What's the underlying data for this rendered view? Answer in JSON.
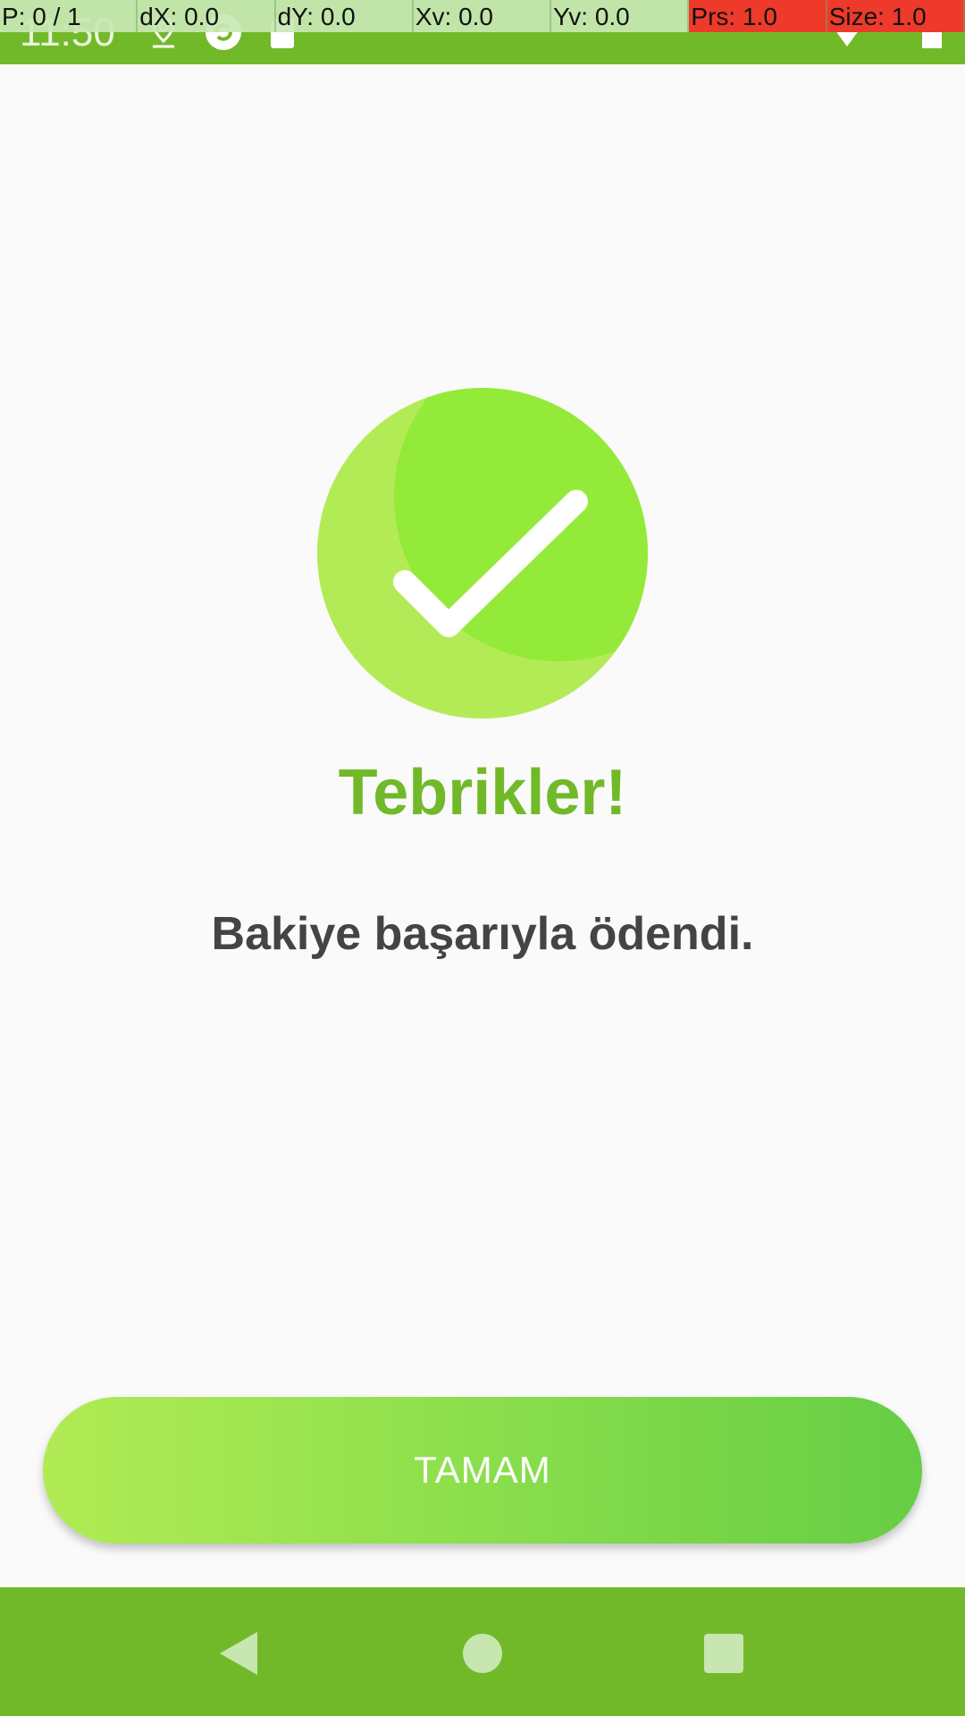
{
  "status_bar": {
    "time": "11:50",
    "icons": [
      "location-icon",
      "sync-icon",
      "sd-card-icon",
      "wifi-icon",
      "battery-icon"
    ],
    "background_color": "#72b92a"
  },
  "pointer_overlay": {
    "cells": [
      {
        "label": "P: 0 / 1"
      },
      {
        "label": "dX: 0.0"
      },
      {
        "label": "dY: 0.0"
      },
      {
        "label": "Xv: 0.0"
      },
      {
        "label": "Yv: 0.0"
      },
      {
        "label": "Prs: 1.0"
      },
      {
        "label": "Size: 1.0"
      }
    ]
  },
  "success": {
    "icon": "checkmark-icon",
    "title": "Tebrikler!",
    "message": "Bakiye başarıyla ödendi.",
    "accent_color": "#72b92a"
  },
  "actions": {
    "ok_label": "TAMAM"
  },
  "nav_bar": {
    "icons": [
      "back-icon",
      "home-icon",
      "recents-icon"
    ]
  }
}
